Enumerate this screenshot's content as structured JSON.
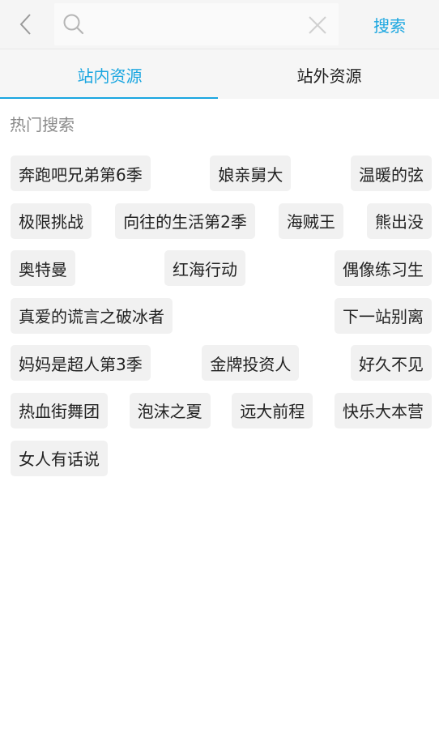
{
  "header": {
    "back_icon": "chevron-left-icon",
    "search_icon": "search-icon",
    "search_placeholder": "",
    "search_value": "",
    "clear_icon": "close-icon",
    "search_button": "搜索"
  },
  "tabs": [
    {
      "label": "站内资源",
      "active": true
    },
    {
      "label": "站外资源",
      "active": false
    }
  ],
  "hot_search": {
    "title": "热门搜索",
    "rows": [
      [
        "奔跑吧兄弟第6季",
        "娘亲舅大",
        "温暖的弦"
      ],
      [
        "极限挑战",
        "向往的生活第2季",
        "海贼王",
        "熊出没"
      ],
      [
        "奥特曼",
        "红海行动",
        "偶像练习生"
      ],
      [
        "真爱的谎言之破冰者",
        "下一站别离"
      ],
      [
        "妈妈是超人第3季",
        "金牌投资人",
        "好久不见"
      ],
      [
        "热血街舞团",
        "泡沫之夏",
        "远大前程",
        "快乐大本营"
      ],
      [
        "女人有话说"
      ]
    ]
  },
  "colors": {
    "accent": "#1aa6e0",
    "tag_bg": "#f1f1f1",
    "header_bg": "#f5f5f5"
  }
}
